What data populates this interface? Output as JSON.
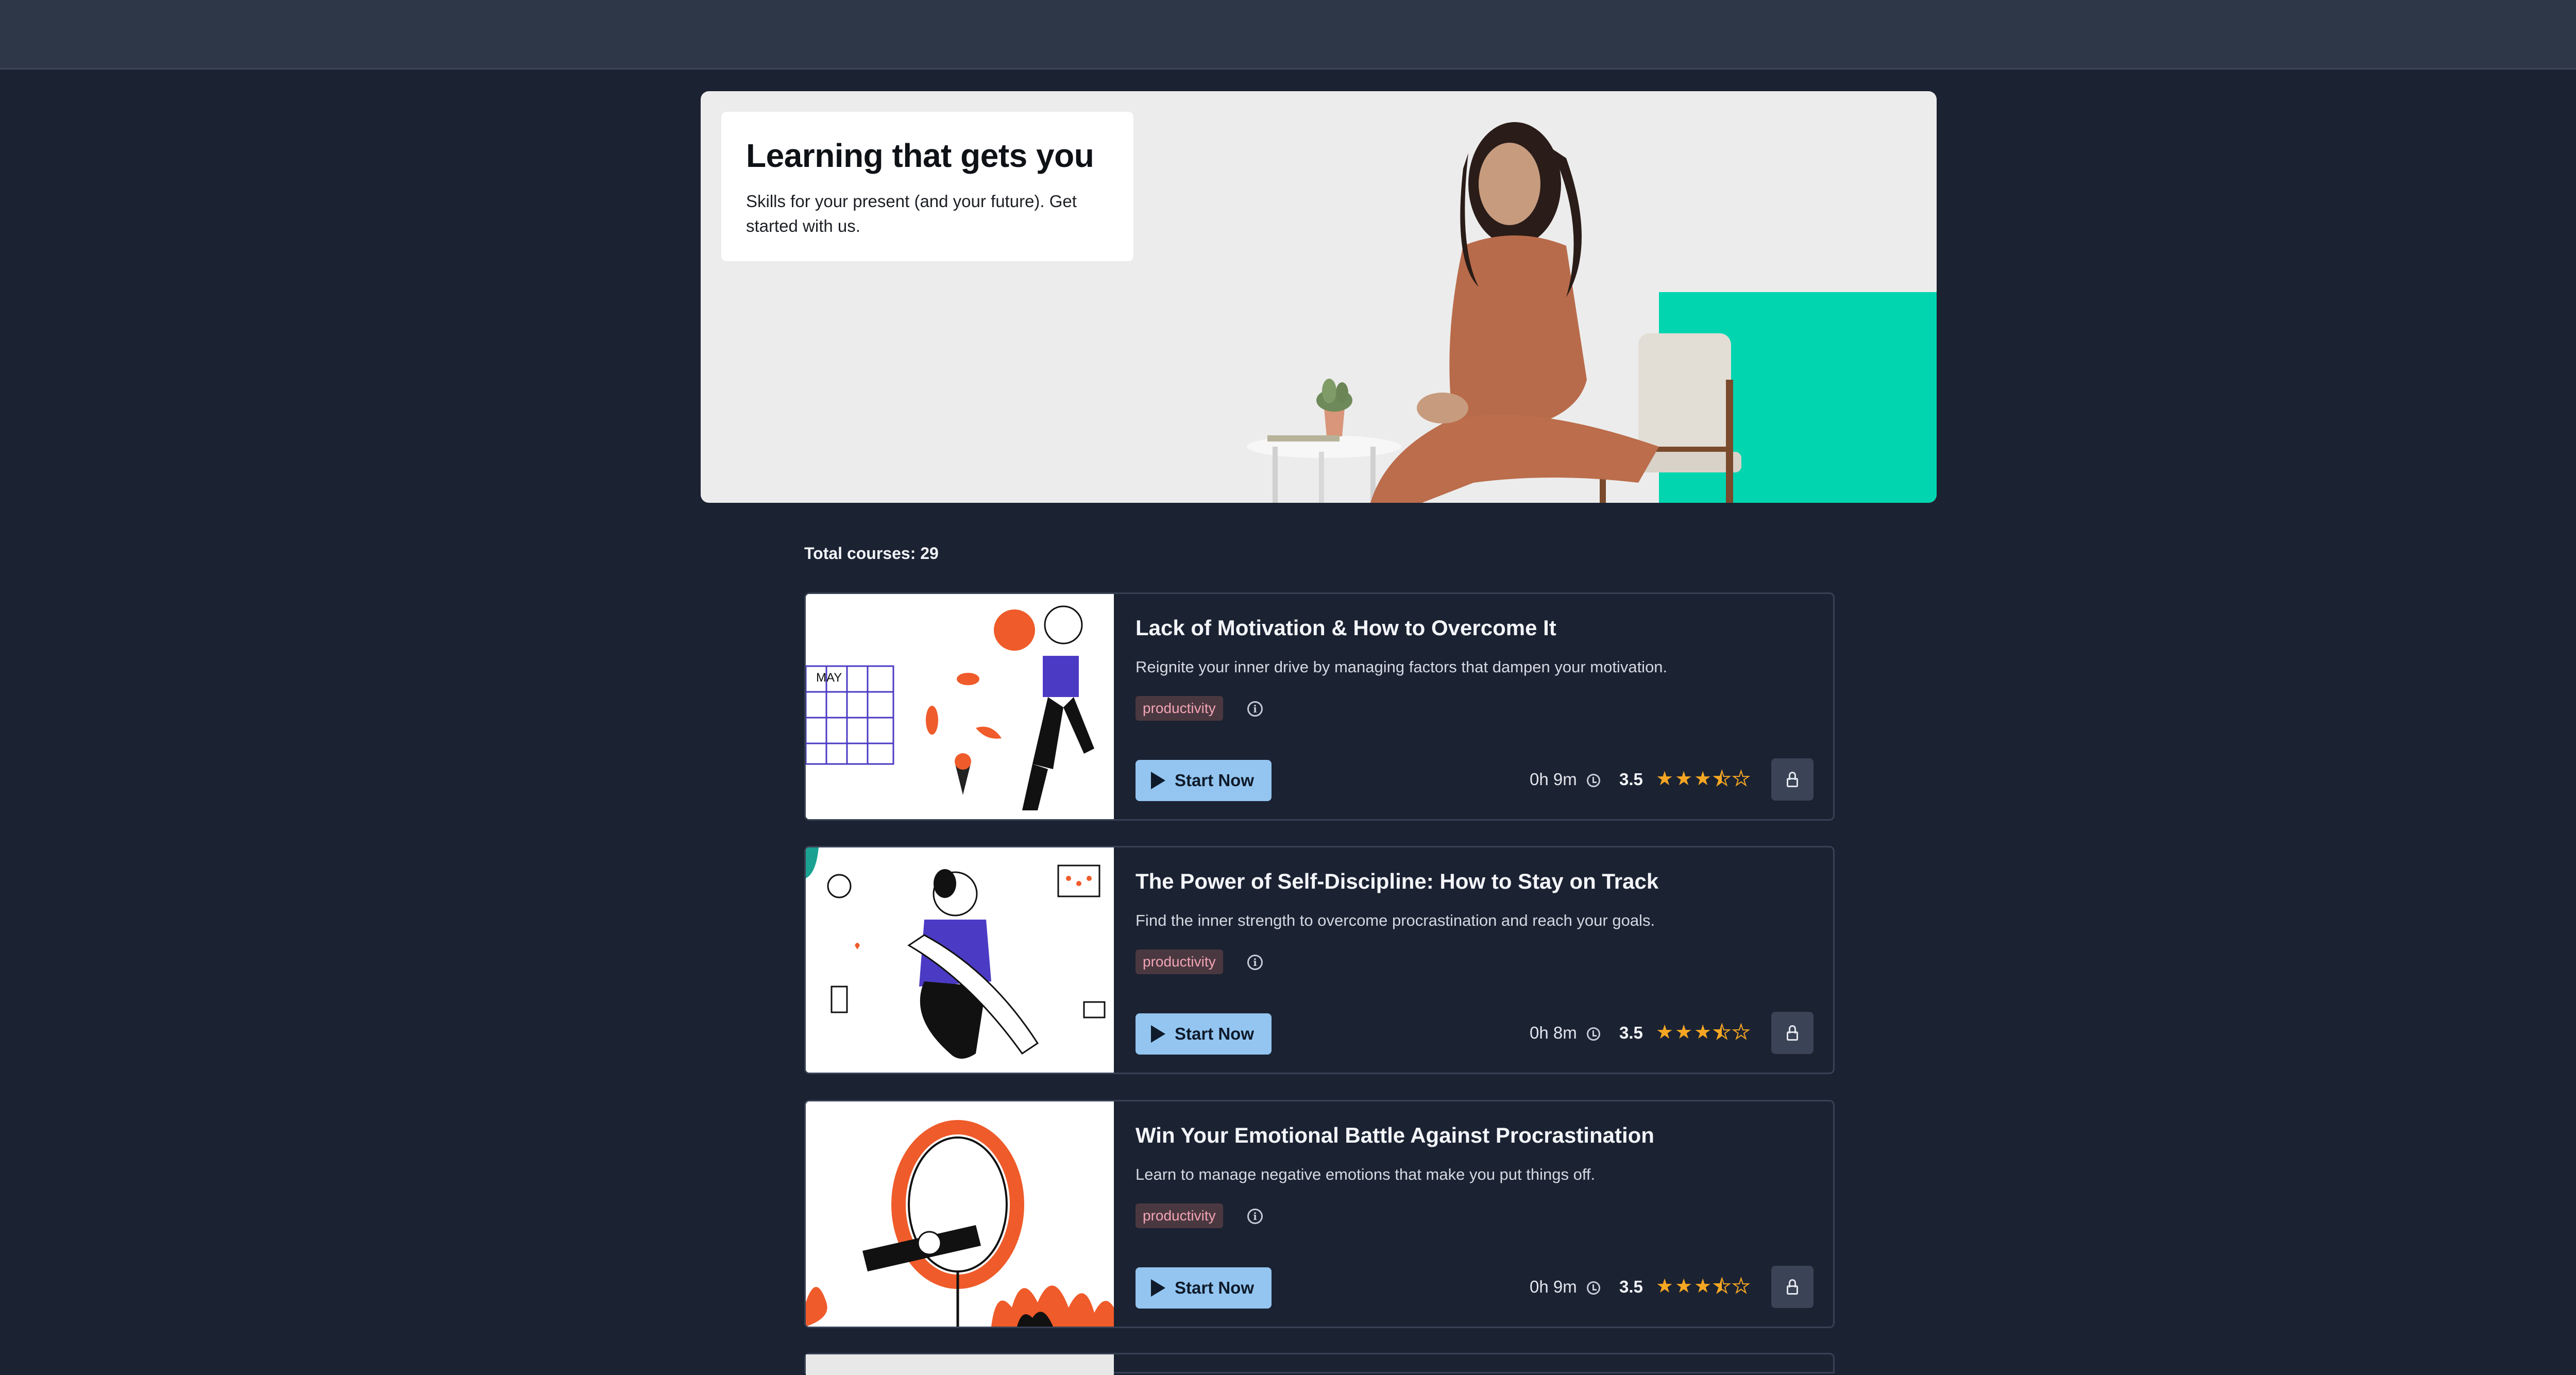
{
  "header": {
    "theme_toggle_icon": "lightbulb-icon",
    "accent": "#f6c343"
  },
  "hero": {
    "title": "Learning that gets you",
    "subtitle": "Skills for your present (and your future). Get started with us.",
    "accent_color": "#00d5b0"
  },
  "courses_summary": {
    "total_label": "Total courses: 29"
  },
  "courses": [
    {
      "title": "Lack of Motivation & How to Overcome It",
      "description": "Reignite your inner drive by managing factors that dampen your motivation.",
      "tag": "productivity",
      "start_label": "Start Now",
      "duration": "0h 9m",
      "rating": "3.5",
      "rating_value": 3.5
    },
    {
      "title": "The Power of Self-Discipline: How to Stay on Track",
      "description": "Find the inner strength to overcome procrastination and reach your goals.",
      "tag": "productivity",
      "start_label": "Start Now",
      "duration": "0h 8m",
      "rating": "3.5",
      "rating_value": 3.5
    },
    {
      "title": "Win Your Emotional Battle Against Procrastination",
      "description": "Learn to manage negative emotions that make you put things off.",
      "tag": "productivity",
      "start_label": "Start Now",
      "duration": "0h 9m",
      "rating": "3.5",
      "rating_value": 3.5
    }
  ],
  "colors": {
    "star": "#f5a623",
    "start_button": "#93c5f0",
    "tag_text": "#f3a5b5"
  }
}
